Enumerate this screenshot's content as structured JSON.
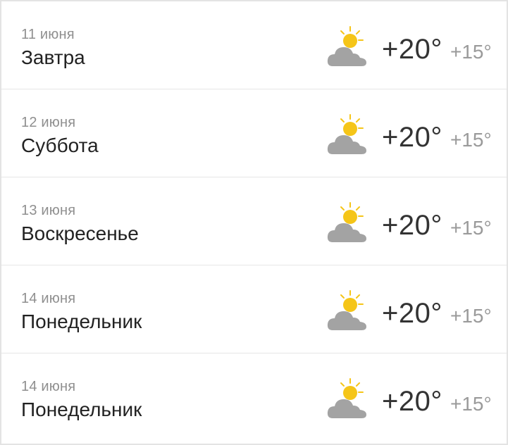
{
  "days": [
    {
      "date": "11 июня",
      "name": "Завтра",
      "temp_day": "+20°",
      "temp_night": "+15°",
      "icon": "partly-cloudy-icon"
    },
    {
      "date": "12 июня",
      "name": "Суббота",
      "temp_day": "+20°",
      "temp_night": "+15°",
      "icon": "partly-cloudy-icon"
    },
    {
      "date": "13 июня",
      "name": "Воскресенье",
      "temp_day": "+20°",
      "temp_night": "+15°",
      "icon": "partly-cloudy-icon"
    },
    {
      "date": "14 июня",
      "name": "Понедельник",
      "temp_day": "+20°",
      "temp_night": "+15°",
      "icon": "partly-cloudy-icon"
    },
    {
      "date": "14 июня",
      "name": "Понедельник",
      "temp_day": "+20°",
      "temp_night": "+15°",
      "icon": "partly-cloudy-icon"
    }
  ],
  "colors": {
    "sun": "#f5c518",
    "cloud": "#a3a3a3",
    "date_text": "#8f8f8f",
    "day_text": "#222222",
    "divider": "#e6e6e6"
  }
}
